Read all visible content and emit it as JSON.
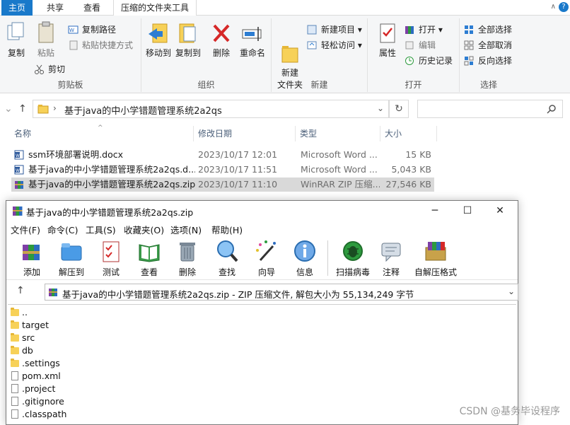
{
  "ribbon_tabs": [
    "主页",
    "共享",
    "查看",
    "压缩的文件夹工具"
  ],
  "ribbon_groups": {
    "clipboard": {
      "label": "剪贴板",
      "copy": "复制",
      "paste": "粘贴",
      "copy_path": "复制路径",
      "paste_shortcut": "粘贴快捷方式",
      "cut": "剪切"
    },
    "organize": {
      "label": "组织",
      "move_to": "移动到",
      "copy_to": "复制到",
      "delete": "删除",
      "rename": "重命名"
    },
    "new": {
      "label": "新建",
      "new_folder": "新建\n文件夹",
      "new_item": "新建项目",
      "easy_access": "轻松访问"
    },
    "open": {
      "label": "打开",
      "properties": "属性",
      "open": "打开",
      "edit": "编辑",
      "history": "历史记录"
    },
    "select": {
      "label": "选择",
      "select_all": "全部选择",
      "select_none": "全部取消",
      "invert": "反向选择"
    }
  },
  "address": {
    "path": "基于java的中小学错题管理系统2a2qs"
  },
  "columns": {
    "name": "名称",
    "date": "修改日期",
    "type": "类型",
    "size": "大小"
  },
  "files": [
    {
      "name": "ssm环境部署说明.docx",
      "date": "2023/10/17 12:01",
      "type": "Microsoft Word ...",
      "size": "15 KB",
      "icon": "word-icon"
    },
    {
      "name": "基于java的中小学错题管理系统2a2qs.d...",
      "date": "2023/10/17 11:51",
      "type": "Microsoft Word ...",
      "size": "5,043 KB",
      "icon": "word-icon"
    },
    {
      "name": "基于java的中小学错题管理系统2a2qs.zip",
      "date": "2023/10/17 11:10",
      "type": "WinRAR ZIP 压缩...",
      "size": "27,546 KB",
      "icon": "winrar-icon"
    }
  ],
  "rar": {
    "title": "基于java的中小学错题管理系统2a2qs.zip",
    "menu": [
      "文件(F)",
      "命令(C)",
      "工具(S)",
      "收藏夹(O)",
      "选项(N)",
      "帮助(H)"
    ],
    "toolbar": [
      "添加",
      "解压到",
      "测试",
      "查看",
      "删除",
      "查找",
      "向导",
      "信息",
      "扫描病毒",
      "注释",
      "自解压格式"
    ],
    "path_info": "基于java的中小学错题管理系统2a2qs.zip - ZIP 压缩文件, 解包大小为 55,134,249 字节",
    "entries": [
      {
        "name": "..",
        "kind": "folder"
      },
      {
        "name": "target",
        "kind": "folder"
      },
      {
        "name": "src",
        "kind": "folder"
      },
      {
        "name": "db",
        "kind": "folder"
      },
      {
        "name": ".settings",
        "kind": "folder"
      },
      {
        "name": "pom.xml",
        "kind": "file"
      },
      {
        "name": ".project",
        "kind": "file"
      },
      {
        "name": ".gitignore",
        "kind": "file"
      },
      {
        "name": ".classpath",
        "kind": "file"
      }
    ]
  },
  "watermark": "CSDN @基务毕设程序"
}
